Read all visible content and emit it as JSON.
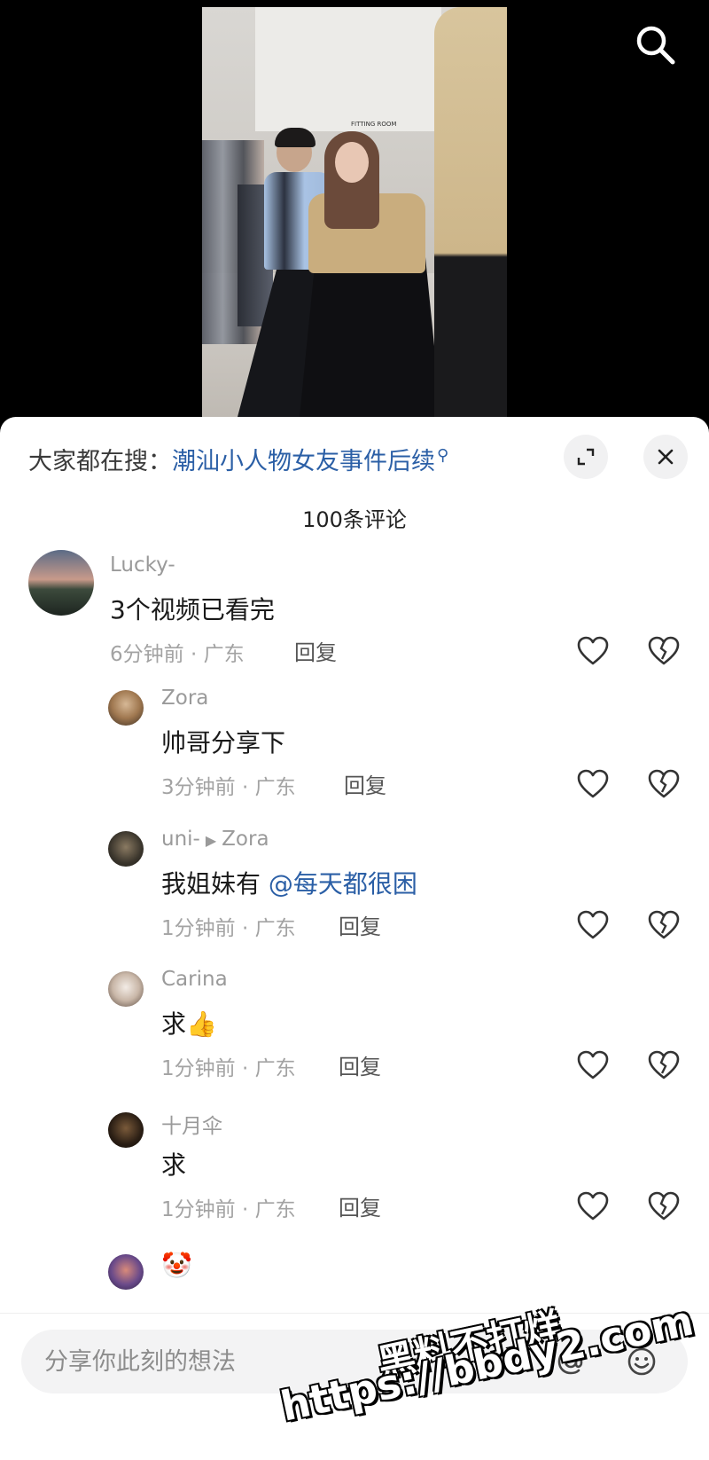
{
  "search": {
    "icon": "search-icon"
  },
  "video": {
    "sign_text": "FITTING ROOM"
  },
  "hot_search": {
    "prefix": "大家都在搜：",
    "query": "潮汕小人物女友事件后续",
    "icon": "search-icon"
  },
  "header": {
    "comment_count": "100条评论",
    "expand_icon": "expand-icon",
    "close_icon": "close-icon"
  },
  "comments": [
    {
      "username": "Lucky-",
      "text": "3个视频已看完",
      "time_location": "6分钟前 · 广东",
      "reply_label": "回复"
    },
    {
      "username": "Zora",
      "text": "帅哥分享下",
      "time_location": "3分钟前 · 广东",
      "reply_label": "回复"
    },
    {
      "username": "uni-",
      "reply_to": "Zora",
      "text": "我姐妹有",
      "mention": "@每天都很困",
      "time_location": "1分钟前 · 广东",
      "reply_label": "回复"
    },
    {
      "username": "Carina",
      "text": "求",
      "emoji": "👍",
      "time_location": "1分钟前 · 广东",
      "reply_label": "回复"
    },
    {
      "username": "十月伞",
      "text": "求",
      "time_location": "1分钟前 · 广东",
      "reply_label": "回复"
    },
    {
      "emoji": "🤡"
    }
  ],
  "input": {
    "placeholder": "分享你此刻的想法"
  },
  "watermark": {
    "line1": "黑料不打烊",
    "line2": "https://bbdy2.com"
  },
  "colors": {
    "link": "#2b5fa6",
    "meta": "#a3a3a3",
    "text": "#1a1a1a"
  }
}
